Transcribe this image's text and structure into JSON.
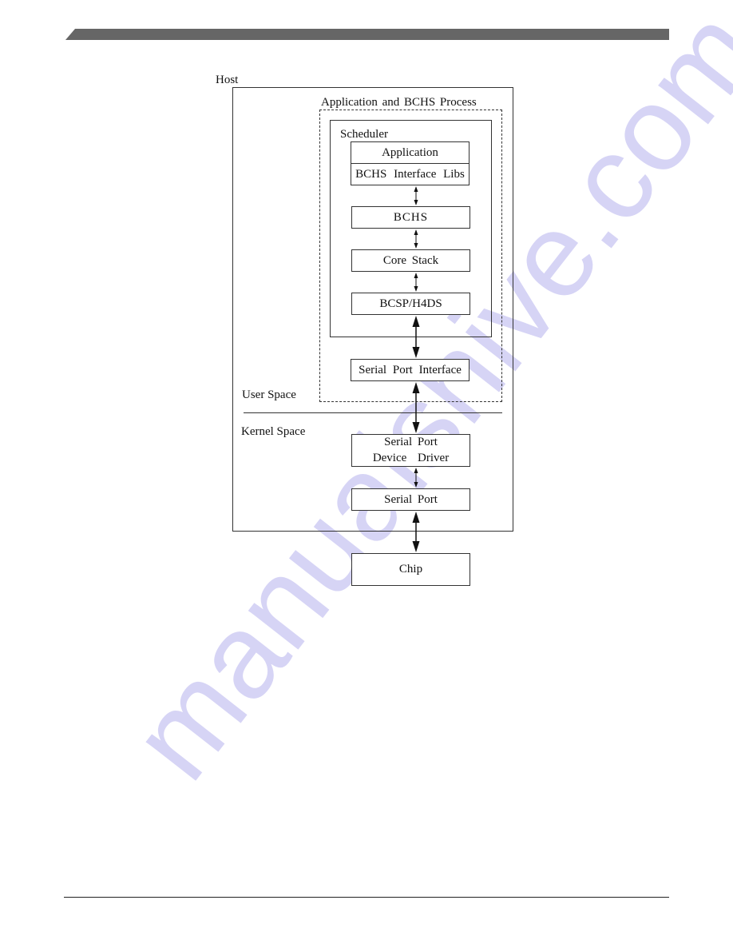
{
  "page": {
    "header_bar_color": "#666666",
    "watermark_text": "manualshive.com",
    "watermark_color": "#c9c6f2"
  },
  "diagram": {
    "host_label": "Host",
    "process_label": "Application and BCHS Process",
    "scheduler_label": "Scheduler",
    "user_space_label": "User Space",
    "kernel_space_label": "Kernel Space",
    "blocks": {
      "application": "Application",
      "bchs_interface_libs": "BCHS Interface Libs",
      "bchs": "BCHS",
      "core_stack": "Core Stack",
      "bcsp_h4ds": "BCSP/H4DS",
      "serial_port_interface": "Serial Port Interface",
      "serial_port_device_driver_line1": "Serial Port",
      "serial_port_device_driver_line2": "Device Driver",
      "serial_port": "Serial Port",
      "chip": "Chip"
    },
    "connections": [
      {
        "from": "BCHS Interface Libs",
        "to": "BCHS",
        "style": "small-bidirectional"
      },
      {
        "from": "BCHS",
        "to": "Core Stack",
        "style": "small-bidirectional"
      },
      {
        "from": "Core Stack",
        "to": "BCSP/H4DS",
        "style": "small-bidirectional"
      },
      {
        "from": "BCSP/H4DS",
        "to": "Serial Port Interface",
        "style": "bold-bidirectional"
      },
      {
        "from": "Serial Port Interface",
        "to": "Serial Port Device Driver",
        "style": "bold-bidirectional"
      },
      {
        "from": "Serial Port Device Driver",
        "to": "Serial Port",
        "style": "small-bidirectional"
      },
      {
        "from": "Serial Port",
        "to": "Chip",
        "style": "bold-bidirectional"
      }
    ]
  }
}
